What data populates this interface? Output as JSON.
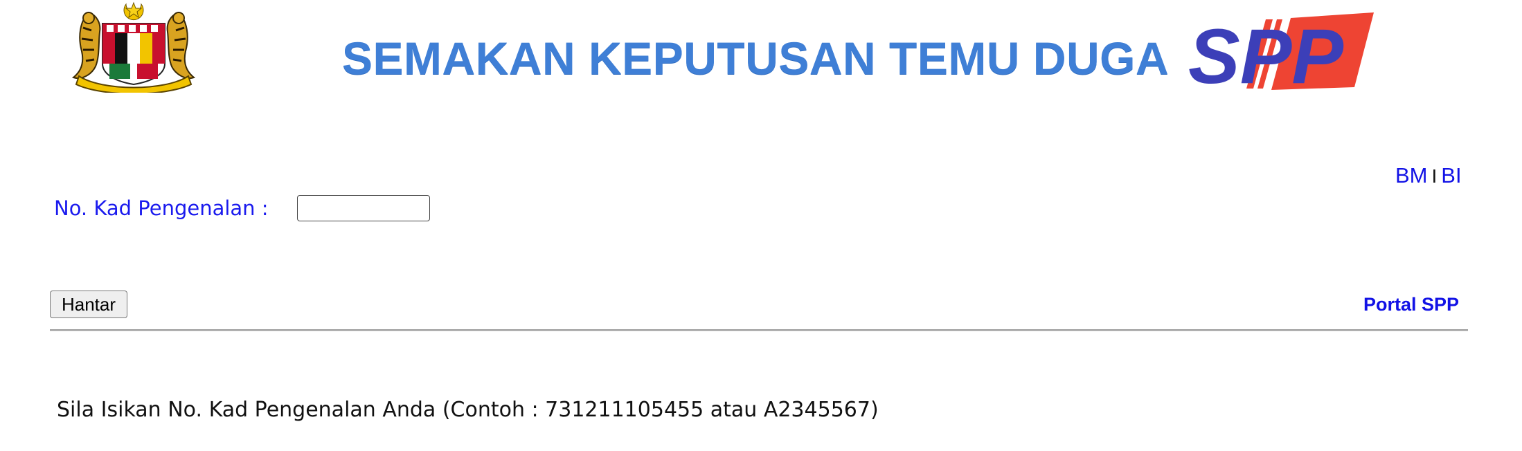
{
  "header": {
    "title": "SEMAKAN KEPUTUSAN TEMU DUGA",
    "logo_left": "malaysia-coat-of-arms",
    "logo_right_text": "SPP",
    "colors": {
      "title": "#3f7fd6",
      "spp_blue": "#3c3fb8",
      "spp_red": "#ee4433"
    }
  },
  "lang": {
    "bm": "BM",
    "sep": "I",
    "bi": "BI"
  },
  "form": {
    "ic_label": "No. Kad Pengenalan :",
    "ic_value": "",
    "submit_label": "Hantar"
  },
  "links": {
    "portal": "Portal SPP"
  },
  "instruction": "Sila Isikan No. Kad Pengenalan Anda (Contoh : 731211105455 atau A2345567)",
  "colors": {
    "link": "#1212e6",
    "label": "#1a1aee"
  }
}
